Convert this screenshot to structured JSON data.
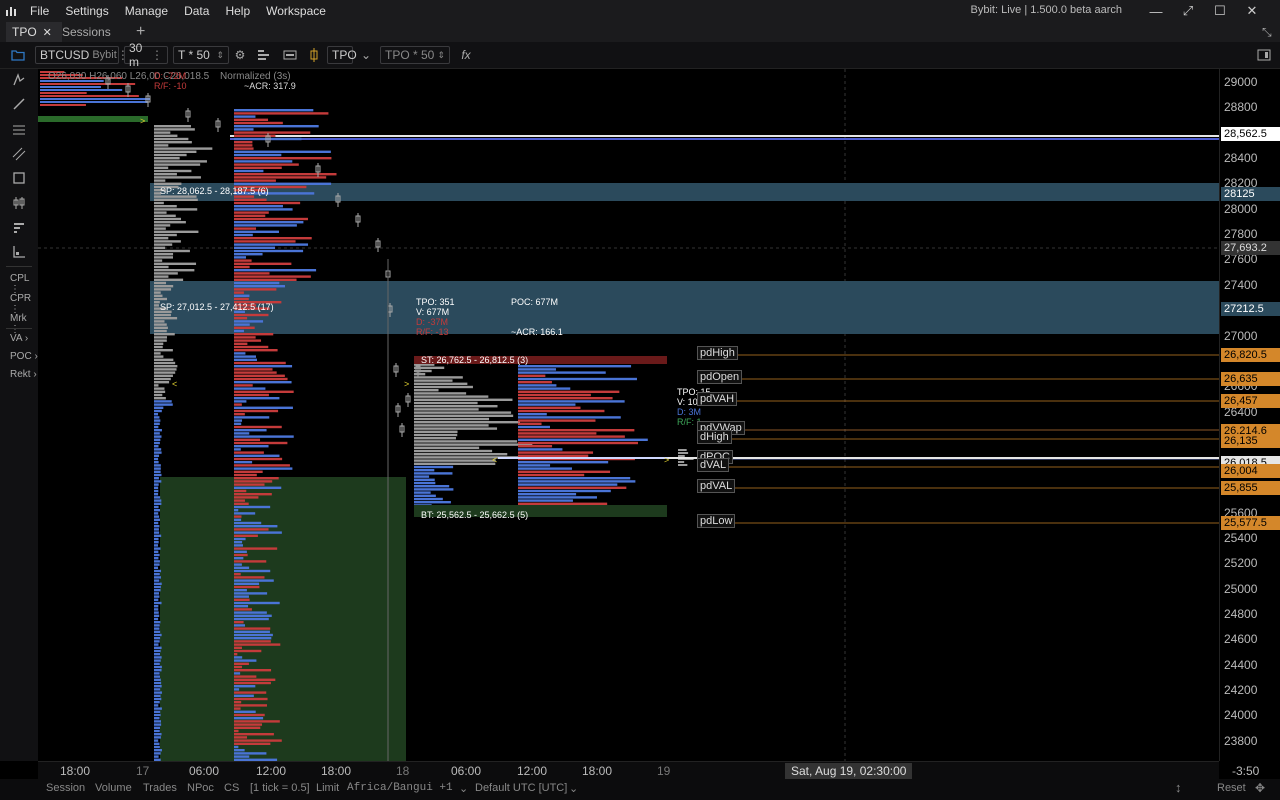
{
  "menu": {
    "items": [
      "File",
      "Settings",
      "Manage",
      "Data",
      "Help",
      "Workspace"
    ],
    "title": "Bybit: Live | 1.500.0 beta aarch"
  },
  "tabs": [
    {
      "label": "TPO",
      "active": true
    },
    {
      "label": "Sessions",
      "active": false
    }
  ],
  "toolbar": {
    "symbol": "BTCUSD",
    "exchange": "Bybit",
    "timeframe": "30 m",
    "tick": "T * 50",
    "chart_type": "TPO",
    "tpo_size": "TPO * 50",
    "fx": "fx"
  },
  "sidebar": {
    "labels": [
      "CPL",
      "CPR",
      "Mrk",
      "VA",
      "POC",
      "Rekt"
    ]
  },
  "chart": {
    "ohlc": "O26,030 H26,060 L26,00 C26,018.5",
    "normalized": "Normalized (3s)",
    "top_delta": "D: -72M",
    "top_rf": "R/F: -10",
    "top_acr": "~ACR: 317.9",
    "sp1": "SP: 28,062.5 - 28,187.5 (6)",
    "sp2": "SP: 27,012.5 - 27,412.5 (17)",
    "stats": {
      "tpo": "TPO: 351",
      "v": "V: 677M",
      "d": "D: -37M",
      "rf": "R/F: -13",
      "poc": "POC: 677M",
      "acr": "~ACR: 166.1"
    },
    "st": "ST: 26,762.5 - 26,812.5 (3)",
    "bt": "BT: 25,562.5 - 25,662.5 (5)",
    "stats2": {
      "tpo": "TPO: 15",
      "v": "V: 10",
      "d": "D: 3M",
      "rf": "R/F: 1"
    },
    "levels": [
      {
        "name": "pdHigh",
        "price": "26,820.5"
      },
      {
        "name": "pdOpen",
        "price": "26,635"
      },
      {
        "name": "pdVAH",
        "price": "26,457"
      },
      {
        "name": "pdVWap",
        "price": "26,214.6"
      },
      {
        "name": "dHigh",
        "price": "26,135"
      },
      {
        "name": "dPOC",
        "price": "26,018.5"
      },
      {
        "name": "dVAL",
        "price": "26,004"
      },
      {
        "name": "pdVAL",
        "price": "25,855"
      },
      {
        "name": "pdLow",
        "price": "25,577.5"
      }
    ]
  },
  "yaxis": {
    "labels": [
      "29000",
      "28800",
      "28400",
      "28200",
      "28000",
      "27800",
      "27600",
      "27400",
      "27000",
      "26600",
      "26400",
      "25600",
      "25400",
      "25200",
      "25000",
      "24800",
      "24600",
      "24400",
      "24200",
      "24000",
      "23800"
    ],
    "tags": {
      "t1": "28,562.5",
      "t2": "28125",
      "t3": "27,693.2",
      "t4": "27212.5"
    },
    "countdown": "-3:50"
  },
  "timeaxis": {
    "labels": [
      "18:00",
      "17",
      "06:00",
      "12:00",
      "18:00",
      "18",
      "06:00",
      "12:00",
      "18:00",
      "19"
    ],
    "cursor": "Sat, Aug 19, 02:30:00"
  },
  "status": {
    "items": [
      "Session",
      "Volume",
      "Trades",
      "NPoc",
      "CS"
    ],
    "tick": "[1 tick = 0.5]",
    "order": "Limit",
    "timezone": "Africa/Bangui +1",
    "utc": "Default UTC [UTC]",
    "reset": "Reset"
  },
  "colors": {
    "accent": "#2f78c4",
    "profile_red": "#c43b3b",
    "profile_blue": "#4a74d6",
    "profile_grey": "#9a9a9a",
    "sp_band": "#2b4a5c",
    "green_zone": "#1d3a1d",
    "level_orange": "#d4872a"
  }
}
